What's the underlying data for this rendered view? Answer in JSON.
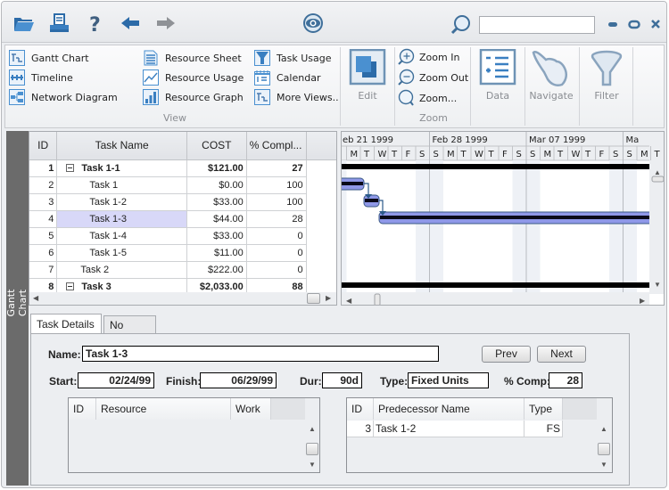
{
  "toolbar": {
    "icons": [
      "open-folder-icon",
      "print-icon",
      "help-icon",
      "back-arrow-icon",
      "forward-arrow-icon",
      "view-eye-icon",
      "search-icon"
    ],
    "search_value": "",
    "window_controls": [
      "minimize-icon",
      "restore-icon",
      "close-icon"
    ]
  },
  "ribbon": {
    "view_group": {
      "label": "View",
      "items": [
        {
          "label": "Gantt Chart",
          "icon": "gantt-chart-icon"
        },
        {
          "label": "Timeline",
          "icon": "timeline-icon"
        },
        {
          "label": "Network Diagram",
          "icon": "network-diagram-icon"
        },
        {
          "label": "Resource Sheet",
          "icon": "resource-sheet-icon"
        },
        {
          "label": "Resource Usage",
          "icon": "resource-usage-icon"
        },
        {
          "label": "Resource Graph",
          "icon": "resource-graph-icon"
        },
        {
          "label": "Task Usage",
          "icon": "task-usage-icon"
        },
        {
          "label": "Calendar",
          "icon": "calendar-icon"
        },
        {
          "label": "More Views..",
          "icon": "more-views-icon"
        }
      ]
    },
    "edit_label": "Edit",
    "zoom_group": {
      "label": "Zoom",
      "items": [
        {
          "label": "Zoom In",
          "icon": "zoom-in-icon"
        },
        {
          "label": "Zoom Out",
          "icon": "zoom-out-icon"
        },
        {
          "label": "Zoom...",
          "icon": "zoom-icon"
        }
      ]
    },
    "data_label": "Data",
    "navigate_label": "Navigate",
    "filter_label": "Filter"
  },
  "sidebar": {
    "label": "Gantt Chart"
  },
  "task_grid": {
    "columns": [
      "ID",
      "Task Name",
      "COST",
      "% Compl..."
    ],
    "rows": [
      {
        "id": "1",
        "name": "Task 1-1",
        "cost": "$121.00",
        "pct": "27",
        "summary": true,
        "level": 0
      },
      {
        "id": "2",
        "name": "Task 1",
        "cost": "$0.00",
        "pct": "100",
        "summary": false,
        "level": 2
      },
      {
        "id": "3",
        "name": "Task 1-2",
        "cost": "$33.00",
        "pct": "100",
        "summary": false,
        "level": 2
      },
      {
        "id": "4",
        "name": "Task 1-3",
        "cost": "$44.00",
        "pct": "28",
        "summary": false,
        "level": 2,
        "selected": true
      },
      {
        "id": "5",
        "name": "Task 1-4",
        "cost": "$33.00",
        "pct": "0",
        "summary": false,
        "level": 2
      },
      {
        "id": "6",
        "name": "Task 1-5",
        "cost": "$11.00",
        "pct": "0",
        "summary": false,
        "level": 2
      },
      {
        "id": "7",
        "name": "Task 2",
        "cost": "$222.00",
        "pct": "0",
        "summary": false,
        "level": 1
      },
      {
        "id": "8",
        "name": "Task 3",
        "cost": "$2,033.00",
        "pct": "88",
        "summary": true,
        "level": 0
      }
    ]
  },
  "gantt": {
    "weeks": [
      "eb 21 1999",
      "Feb 28 1999",
      "Mar 07 1999",
      "Ma"
    ],
    "days": [
      "S",
      "M",
      "T",
      "W",
      "T",
      "F",
      "S"
    ]
  },
  "details": {
    "tabs": [
      {
        "label": "Task Details",
        "active": true
      },
      {
        "label": "No Notes",
        "active": false
      }
    ],
    "name_label": "Name:",
    "name_value": "Task 1-3",
    "prev_label": "Prev",
    "next_label": "Next",
    "start_label": "Start:",
    "start_value": "02/24/99",
    "finish_label": "Finish:",
    "finish_value": "06/29/99",
    "dur_label": "Dur:",
    "dur_value": "90d",
    "type_label": "Type:",
    "type_value": "Fixed Units",
    "comp_label": "% Comp:",
    "comp_value": "28",
    "resources": {
      "columns": [
        "ID",
        "Resource",
        "Work"
      ],
      "rows": []
    },
    "predecessors": {
      "columns": [
        "ID",
        "Predecessor Name",
        "Type"
      ],
      "rows": [
        {
          "id": "3",
          "name": "Task 1-2",
          "type": "FS"
        }
      ]
    }
  },
  "colors": {
    "accent_blue": "#3a7fc1",
    "bar_fill": "#8f98e8",
    "sidebar": "#6b6b6b",
    "selected_row": "#d8d8f8"
  }
}
